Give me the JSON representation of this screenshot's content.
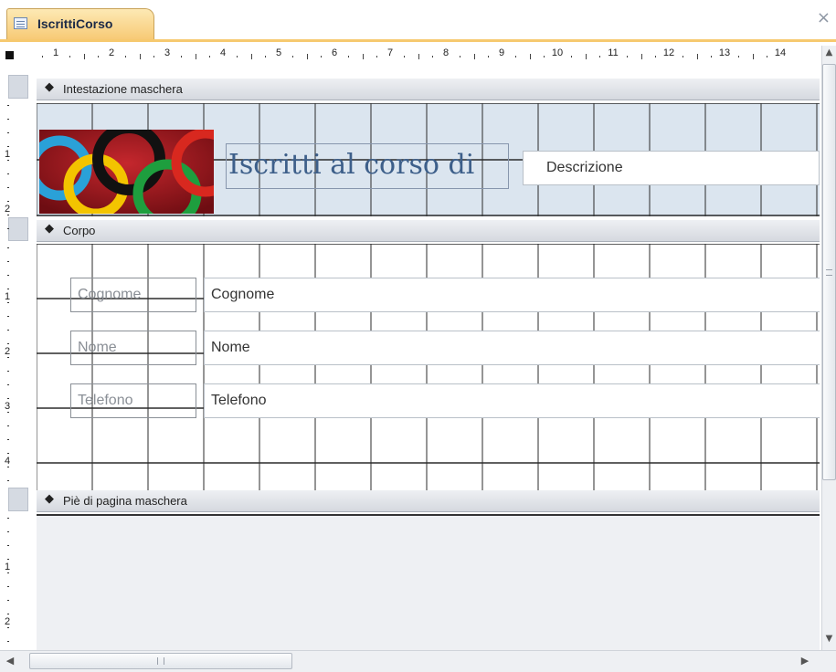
{
  "tab": {
    "title": "IscrittiCorso"
  },
  "ruler": {
    "horizontal_numbers": [
      "1",
      "2",
      "3",
      "4",
      "5",
      "6",
      "7",
      "8",
      "9",
      "10",
      "11",
      "12",
      "13",
      "14"
    ]
  },
  "sections": {
    "header": {
      "label": "Intestazione maschera"
    },
    "body": {
      "label": "Corpo"
    },
    "footer": {
      "label": "Piè di pagina maschera"
    }
  },
  "header_controls": {
    "title": "Iscritti al corso di",
    "description_field": "Descrizione"
  },
  "fields": [
    {
      "label": "Cognome",
      "value": "Cognome"
    },
    {
      "label": "Nome",
      "value": "Nome"
    },
    {
      "label": "Telefono",
      "value": "Telefono"
    }
  ],
  "icons": {
    "tab": "form-icon",
    "close": "close-icon",
    "section_arrow": "section-arrow-icon",
    "scroll_up": "scroll-up-icon",
    "scroll_down": "scroll-down-icon",
    "scroll_left": "scroll-left-icon",
    "scroll_right": "scroll-right-icon"
  },
  "colors": {
    "tab_active": "#f7c974",
    "header_background": "#dbe5ef",
    "title_text": "#3d5f8a",
    "label_text": "#8a8f96"
  }
}
